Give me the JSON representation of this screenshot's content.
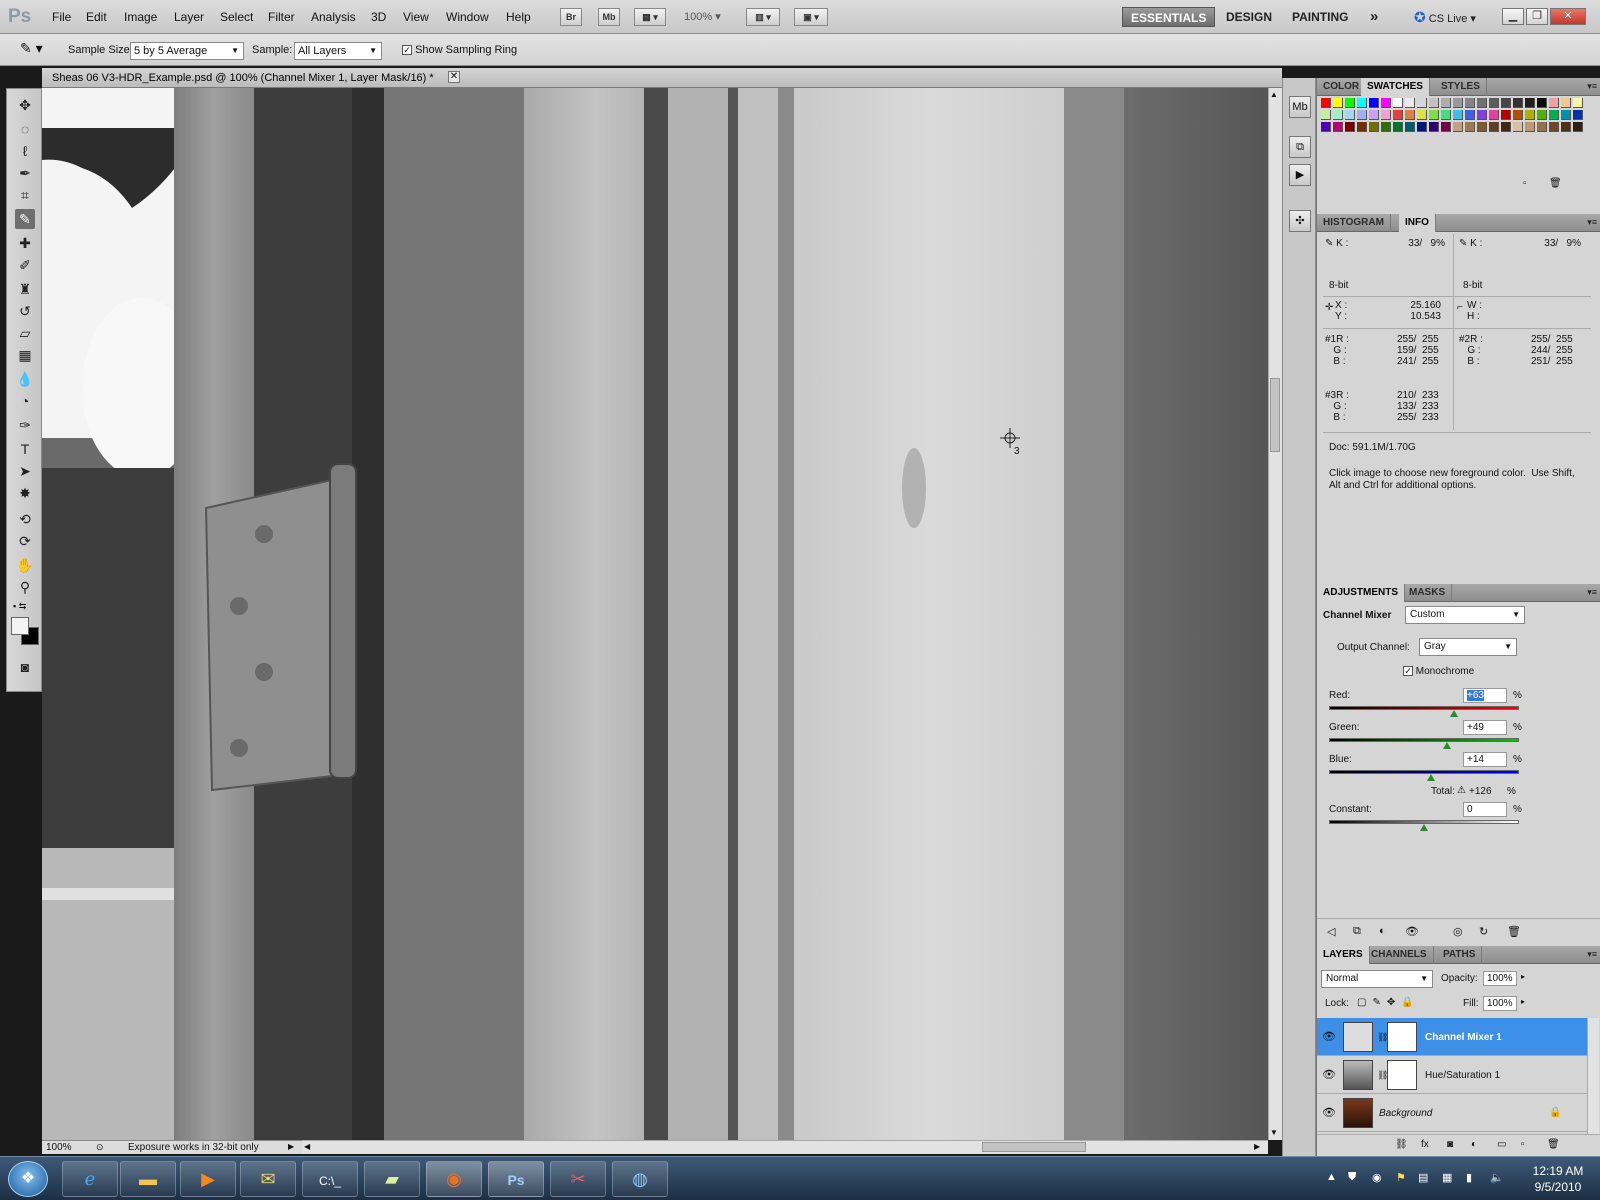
{
  "app": {
    "logo": "Ps"
  },
  "menubar": {
    "items": [
      "File",
      "Edit",
      "Image",
      "Layer",
      "Select",
      "Filter",
      "Analysis",
      "3D",
      "View",
      "Window",
      "Help"
    ],
    "br": "Br",
    "mb": "Mb",
    "zoom": "100%",
    "workspaces": {
      "essentials": "ESSENTIALS",
      "design": "DESIGN",
      "painting": "PAINTING",
      "more": "»"
    },
    "cs_live": "CS Live"
  },
  "options": {
    "sample_size_label": "Sample Size:",
    "sample_size_value": "5 by 5 Average",
    "sample_label": "Sample:",
    "sample_value": "All Layers",
    "sampling_ring_label": "Show Sampling Ring",
    "sampling_ring_checked": "✓"
  },
  "document": {
    "tab_title": "Sheas 06 V3-HDR_Example.psd @ 100% (Channel Mixer 1, Layer Mask/16) *",
    "close": "✕",
    "zoom": "100%",
    "status": "Exposure works in 32-bit only",
    "sampler_label": "3"
  },
  "swatches_panel": {
    "tabs": [
      "COLOR",
      "SWATCHES",
      "STYLES"
    ],
    "colors": [
      "#ff0000",
      "#ffff00",
      "#00ff00",
      "#00ffff",
      "#0000ff",
      "#ff00ff",
      "#ffffff",
      "#ebebeb",
      "#d6d6d6",
      "#c2c2c2",
      "#adadad",
      "#999999",
      "#858585",
      "#707070",
      "#5c5c5c",
      "#474747",
      "#333333",
      "#1f1f1f",
      "#0a0a0a",
      "#f0a0a0",
      "#f0c890",
      "#f8f8a0",
      "#c0f0a0",
      "#a0f0c8",
      "#a0d8f0",
      "#a0b0f0",
      "#c8a0f0",
      "#f0a0d8",
      "#e04040",
      "#e08040",
      "#e0e040",
      "#80e040",
      "#40e080",
      "#40c0e0",
      "#4060e0",
      "#8040e0",
      "#e040a0",
      "#b00000",
      "#b05000",
      "#b0b000",
      "#50b000",
      "#00b050",
      "#0090b0",
      "#0030b0",
      "#5000b0",
      "#b00070",
      "#700000",
      "#703000",
      "#707000",
      "#307000",
      "#007030",
      "#005870",
      "#001870",
      "#300070",
      "#700048",
      "#c8a080",
      "#a07850",
      "#805830",
      "#604020",
      "#402810",
      "#d8c0a0",
      "#c09870",
      "#987048",
      "#704828",
      "#503018",
      "#302010"
    ]
  },
  "info_panel": {
    "tabs": [
      "HISTOGRAM",
      "INFO"
    ],
    "k_left_label": "K :",
    "k_left_value": "33/   9%",
    "k_right_label": "K :",
    "k_right_value": "33/   9%",
    "bit_left": "8-bit",
    "bit_right": "8-bit",
    "x_label": "X :",
    "x_value": "25.160",
    "y_label": "Y :",
    "y_value": "10.543",
    "w_label": "W :",
    "h_label": "H :",
    "s1": {
      "label": "#1R :\n   G :\n   B :",
      "values": "255/  255\n159/  255\n241/  255"
    },
    "s2": {
      "label": "#2R :\n   G :\n   B :",
      "values": "255/  255\n244/  255\n251/  255"
    },
    "s3": {
      "label": "#3R :\n   G :\n   B :",
      "values": "210/  233\n133/  233\n255/  233"
    },
    "doc": "Doc: 591.1M/1.70G",
    "hint": "Click image to choose new foreground color.  Use Shift,\nAlt and Ctrl for additional options."
  },
  "adjustments_panel": {
    "tabs": [
      "ADJUSTMENTS",
      "MASKS"
    ],
    "title": "Channel Mixer",
    "preset": "Custom",
    "output_label": "Output Channel:",
    "output_value": "Gray",
    "monochrome_label": "Monochrome",
    "monochrome_checked": "✓",
    "red_label": "Red:",
    "red_value": "+63",
    "green_label": "Green:",
    "green_value": "+49",
    "blue_label": "Blue:",
    "blue_value": "+14",
    "total_label": "Total:",
    "total_value": "+126",
    "constant_label": "Constant:",
    "constant_value": "0",
    "pct": "%",
    "red_level": 63,
    "green_level": 49,
    "blue_level": 14,
    "constant_level": 0
  },
  "layers_panel": {
    "tabs": [
      "LAYERS",
      "CHANNELS",
      "PATHS"
    ],
    "blend_mode": "Normal",
    "opacity_label": "Opacity:",
    "opacity_value": "100%",
    "lock_label": "Lock:",
    "fill_label": "Fill:",
    "fill_value": "100%",
    "layers": [
      {
        "name": "Channel Mixer 1",
        "selected": true
      },
      {
        "name": "Hue/Saturation 1",
        "selected": false
      },
      {
        "name": "Background",
        "selected": false
      }
    ]
  },
  "taskbar": {
    "time": "12:19 AM",
    "date": "9/5/2010"
  }
}
